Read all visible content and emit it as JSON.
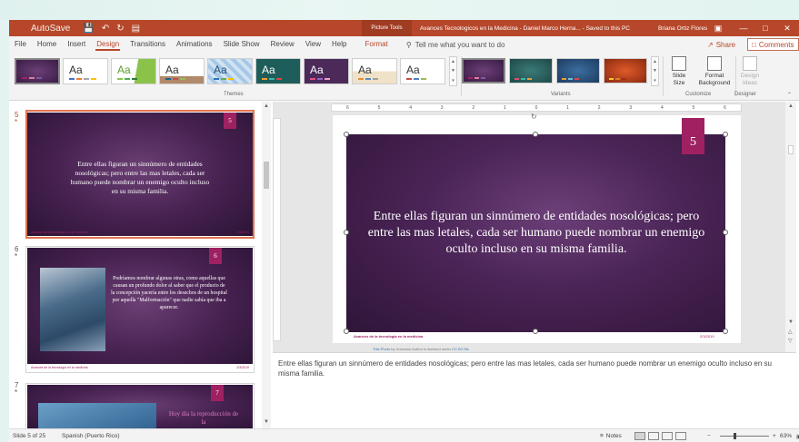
{
  "titlebar": {
    "autosave": "AutoSave",
    "contextual_tab": "Picture Tools",
    "doc_title": "Avances Tecnologicos en la Medicina - Daniel Marco Herna...  -  Saved to this PC",
    "user": "Briana Ortiz Flores",
    "icons": [
      "save-icon",
      "undo-icon",
      "redo-icon",
      "present-icon",
      "ribbon-display-icon",
      "minimize-icon",
      "maximize-icon",
      "close-icon"
    ]
  },
  "tabs": [
    "File",
    "Home",
    "Insert",
    "Design",
    "Transitions",
    "Animations",
    "Slide Show",
    "Review",
    "View",
    "Help",
    "Format"
  ],
  "active_tab": "Design",
  "tell_me": "Tell me what you want to do",
  "share_label": "Share",
  "comments_label": "Comments",
  "ribbon": {
    "themes_label": "Themes",
    "variants_label": "Variants",
    "customize_label": "Customize",
    "designer_label": "Designer",
    "theme_aa": "Aa",
    "slide_size": "Slide\nSize",
    "format_background": "Format\nBackground",
    "design_ideas": "Design\nIdeas"
  },
  "thumbnails": [
    {
      "num": "5",
      "star": "*",
      "badge": "5",
      "text": "Entre ellas figuran un sinnúmero de entidades nosológicas; pero entre las mas letales, cada ser humano puede nombrar un enemigo oculto incluso en su misma familia.",
      "footer_left": "Avances de la tecnología en la medicina",
      "footer_right": "2/3/2019"
    },
    {
      "num": "6",
      "star": "*",
      "badge": "6",
      "text": "Podríamos nombrar algunas otras, como aquellas que causan un profundo dolor al saber que el producto de la concepción yacería entre los desechos de un hospital por aquella \"Malformación\" que nadie sabía que iba a aparecer.",
      "footer_left": "Avances de la tecnología en la medicina",
      "footer_right": "2/3/2019"
    },
    {
      "num": "7",
      "star": "*",
      "badge": "7",
      "text": "Hoy dia la reproducción de la"
    }
  ],
  "slide": {
    "badge": "5",
    "body": "Entre ellas figuran un sinnúmero de entidades nosológicas; pero entre las mas letales, cada ser humano puede nombrar un enemigo oculto incluso en su misma familia.",
    "footer_left": "Avances de la tecnología en la medicina",
    "footer_right": "2/3/2019",
    "attribution_link1": "This Photo",
    "attribution_mid": "by Unknown Author is licensed under",
    "attribution_link2": "CC BY-SA"
  },
  "ruler_ticks": [
    "6",
    "5",
    "4",
    "3",
    "2",
    "1",
    "0",
    "1",
    "2",
    "3",
    "4",
    "5",
    "6"
  ],
  "notes": "Entre ellas figuran un sinnúmero de entidades nosológicas; pero entre las mas letales, cada ser humano puede nombrar un enemigo oculto incluso en su misma familia.",
  "statusbar": {
    "slide_info": "Slide 5 of 25",
    "language": "Spanish (Puerto Rico)",
    "notes_label": "Notes",
    "zoom": "63%",
    "zoom_level": 0.63
  },
  "colors": {
    "accent": "#b7472a",
    "slide_badge": "#9f2161",
    "slide_bg": "#4a2456"
  }
}
